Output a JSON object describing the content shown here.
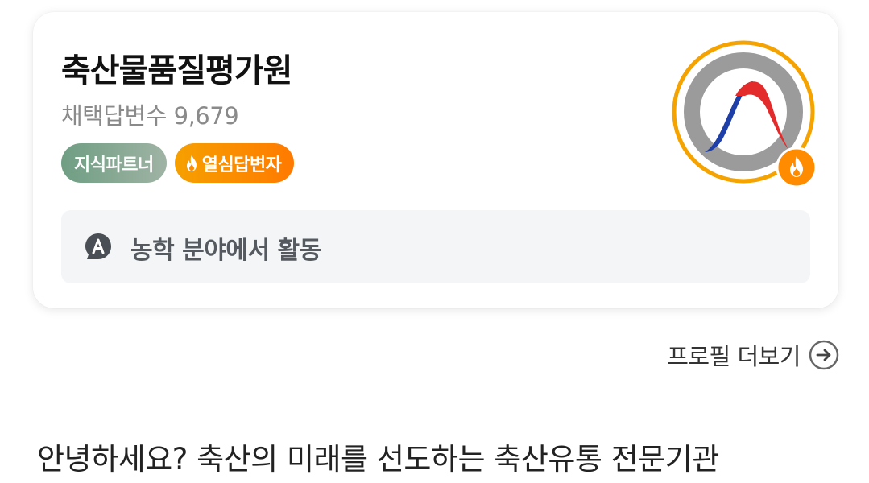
{
  "profile": {
    "name": "축산물품질평가원",
    "stats_label": "채택답변수",
    "stats_value": "9,679",
    "badges": [
      {
        "label": "지식파트너",
        "color": "#7fa58d"
      },
      {
        "label": "열심답변자",
        "color": "#ff8c00",
        "icon": "fire-icon"
      }
    ],
    "field_icon": "a-circle-icon",
    "field_text": "농학 분야에서 활동",
    "avatar_icon": "apgp-logo",
    "avatar_badge_icon": "fire-icon"
  },
  "links": {
    "profile_more": "프로필 더보기",
    "profile_more_icon": "arrow-right-circle-icon"
  },
  "intro_text": "안녕하세요? 축산의 미래를 선도하는 축산유통 전문기관",
  "colors": {
    "accent_orange": "#ff8c00",
    "partner_green": "#7fa58d",
    "logo_red": "#e32b2b",
    "logo_blue": "#1f3fa8"
  }
}
